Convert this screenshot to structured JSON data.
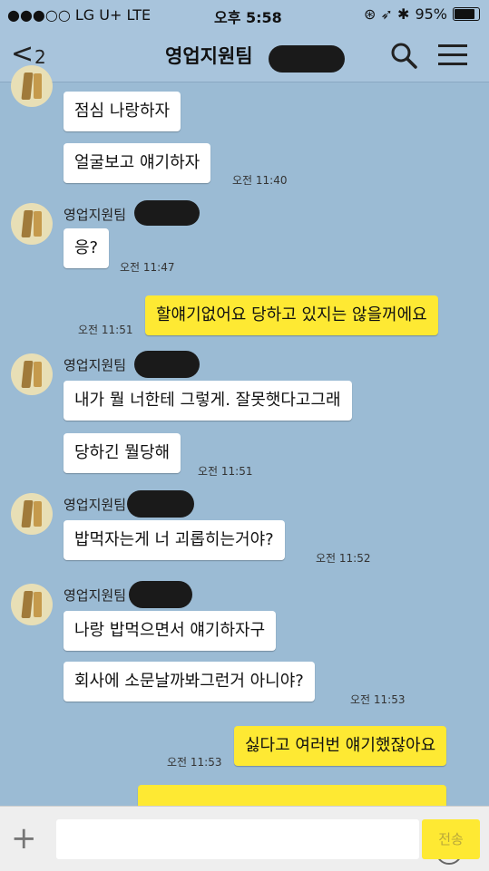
{
  "status": {
    "carrier": "●●●○○ LG U+  LTE",
    "time": "오후 5:58",
    "icons": "⊛ ➶ ✱",
    "battery": "95%"
  },
  "header": {
    "back_count": "2",
    "title": "영업지원팀"
  },
  "messages": [
    {
      "sender": "",
      "text": "점심 나랑하자",
      "time": ""
    },
    {
      "sender": "",
      "text": "얼굴보고 얘기하자",
      "time": "오전 11:40"
    },
    {
      "sender": "영업지원팀",
      "text": "응?",
      "time": "오전 11:47"
    },
    {
      "sender": "me",
      "text": "할얘기없어요 당하고 있지는 않을꺼에요",
      "time": "오전 11:51"
    },
    {
      "sender": "영업지원팀",
      "text": "내가 뭘 너한테 그렇게. 잘못햇다고그래",
      "time": ""
    },
    {
      "sender": "",
      "text": "당하긴 뭘당해",
      "time": "오전 11:51"
    },
    {
      "sender": "영업지원팀",
      "text": "밥먹자는게 너 괴롭히는거야?",
      "time": "오전 11:52"
    },
    {
      "sender": "영업지원팀",
      "text": "나랑 밥먹으면서 얘기하자구",
      "time": ""
    },
    {
      "sender": "",
      "text": "회사에 소문날까봐그런거 아니야?",
      "time": "오전 11:53"
    },
    {
      "sender": "me",
      "text": "싫다고 여러번 얘기했잖아요",
      "time": "오전 11:53"
    }
  ],
  "input": {
    "send_label": "전송"
  }
}
